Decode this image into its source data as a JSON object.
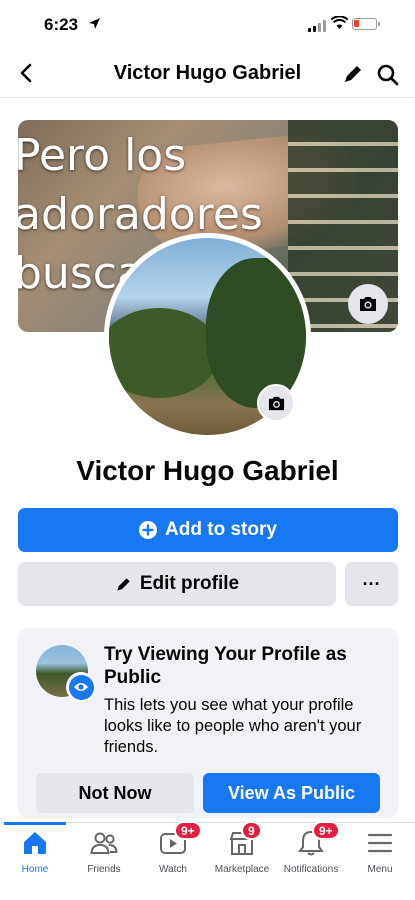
{
  "status_bar": {
    "time": "6:23"
  },
  "header": {
    "title": "Victor Hugo Gabriel"
  },
  "cover": {
    "text": "Pero los\nadoradores\nbusca"
  },
  "profile": {
    "name": "Victor Hugo Gabriel"
  },
  "actions": {
    "add_story_label": "Add to story",
    "edit_profile_label": "Edit profile",
    "more_label": "···"
  },
  "public_prompt": {
    "title": "Try Viewing Your Profile as Public",
    "description": "This lets you see what your profile looks like to people who aren't your friends.",
    "not_now_label": "Not Now",
    "view_public_label": "View As Public"
  },
  "tabs": [
    {
      "label": "Home",
      "icon": "home-icon",
      "active": true
    },
    {
      "label": "Friends",
      "icon": "friends-icon"
    },
    {
      "label": "Watch",
      "icon": "watch-icon",
      "badge": "9+"
    },
    {
      "label": "Marketplace",
      "icon": "marketplace-icon",
      "badge": "9"
    },
    {
      "label": "Notifications",
      "icon": "bell-icon",
      "badge": "9+"
    },
    {
      "label": "Menu",
      "icon": "menu-icon"
    }
  ],
  "colors": {
    "accent": "#1877f2",
    "badge": "#e41e3f",
    "secondary_button": "#e4e6eb"
  }
}
